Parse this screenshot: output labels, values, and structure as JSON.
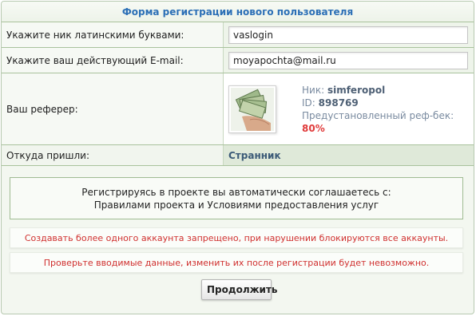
{
  "form": {
    "title": "Форма регистрации нового пользователя",
    "nick_label": "Укажите ник латинскими буквами:",
    "nick_value": "vaslogin",
    "email_label": "Укажите ваш действующий E-mail:",
    "email_value": "moyapochta@mail.ru",
    "referrer_label": "Ваш реферер:",
    "referrer": {
      "nick_prefix": "Ник:",
      "nick": "simferopol",
      "id_prefix": "ID:",
      "id": "898769",
      "refback_prefix": "Предустановленный реф-бек:",
      "refback": "80%",
      "avatar_icon": "money-hand-icon"
    },
    "source_label": "Откуда пришли:",
    "source_value": "Странник"
  },
  "notice": {
    "line1": "Регистрируясь в проекте вы автоматически соглашаетесь с:",
    "line2": "Правилами проекта и Условиями предоставления услуг"
  },
  "warnings": {
    "w1": "Создавать более одного аккаунта запрещено, при нарушении блокируются все аккаунты.",
    "w2": "Проверьте вводимые данные, изменить их после регистрации будет невозможно."
  },
  "submit_label": "Продолжить",
  "colors": {
    "title": "#2b6fb6",
    "warning": "#d0302f",
    "refback": "#e03b3b"
  }
}
